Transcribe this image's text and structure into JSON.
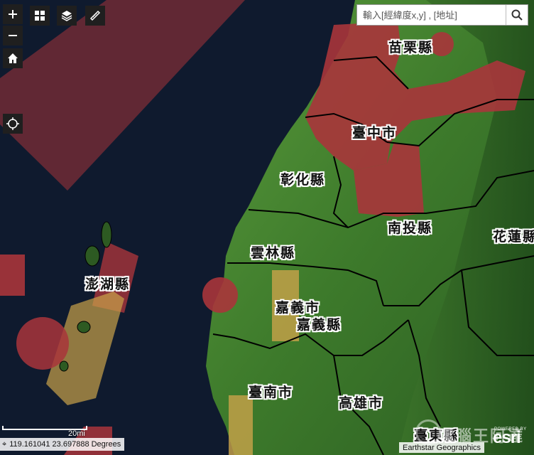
{
  "toolbar": {
    "zoom_in": "zoom-in",
    "zoom_out": "zoom-out",
    "home": "home",
    "basemap_gallery": "grid",
    "layers": "layers",
    "measure": "ruler",
    "locate": "crosshair"
  },
  "search": {
    "placeholder": "輸入[經緯度x,y] , [地址]"
  },
  "map": {
    "labels": {
      "miaoli": "苗栗縣",
      "taichung": "臺中市",
      "changhua": "彰化縣",
      "nantou": "南投縣",
      "hualien": "花蓮縣",
      "yunlin": "雲林縣",
      "penghu": "澎湖縣",
      "chiayi_city": "嘉義市",
      "chiayi_county": "嘉義縣",
      "tainan": "臺南市",
      "kaohsiung": "高雄市",
      "taitung": "臺東縣"
    },
    "colors": {
      "sea": "#0f1a2e",
      "land": "#3f7a2d",
      "red_zone": "#a8353b",
      "yellow_zone": "#c9a24a",
      "boundary": "#000000"
    }
  },
  "footer": {
    "coordinates": "119.161041 23.697888 Degrees",
    "scale": "20mi",
    "attribution": "Earthstar Geographics",
    "esri_small": "POWERED BY",
    "esri": "esri",
    "watermark": "電腦王阿達"
  }
}
